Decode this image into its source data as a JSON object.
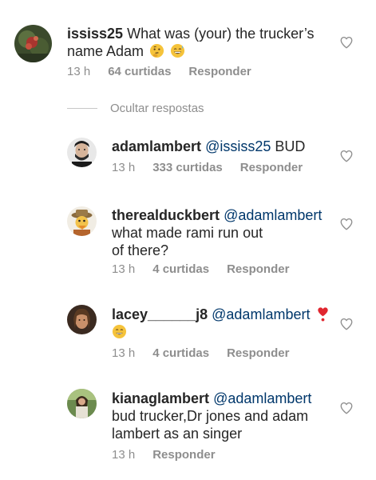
{
  "comments": [
    {
      "username": "ississ25",
      "text": "What was (your) the trucker’s name Adam",
      "time": "13 h",
      "likes": "64 curtidas",
      "reply": "Responder",
      "emojis": [
        "thinking-face-emoji",
        "grinning-sweat-emoji"
      ]
    },
    {
      "username": "adamlambert",
      "mention": "@ississ25",
      "text": "BUD",
      "time": "13 h",
      "likes": "333 curtidas",
      "reply": "Responder"
    },
    {
      "username": "therealduckbert",
      "mention": "@adamlambert",
      "text_line1": "what made rami run out",
      "text_line2": "of there?",
      "time": "13 h",
      "likes": "4 curtidas",
      "reply": "Responder"
    },
    {
      "username": "lacey______j8",
      "mention": "@adamlambert",
      "time": "13 h",
      "likes": "4 curtidas",
      "reply": "Responder",
      "emojis": [
        "heart-exclamation-emoji",
        "smiling-face-emoji"
      ]
    },
    {
      "username": "kianaglambert",
      "mention": "@adamlambert",
      "text_line1": "bud trucker,Dr jones and adam",
      "text_line2": "lambert as an singer",
      "time": "13 h",
      "reply": "Responder"
    }
  ],
  "hide_replies": "Ocultar respostas",
  "colors": {
    "text": "#262626",
    "meta": "#8e8e8e",
    "mention": "#00376b",
    "divider": "#c7c7c7"
  },
  "icons": {
    "like": "heart-outline-icon"
  }
}
